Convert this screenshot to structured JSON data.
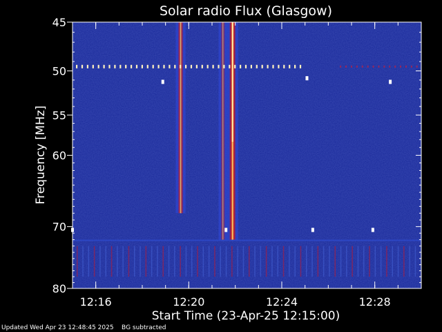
{
  "chart_data": {
    "type": "heatmap",
    "title": "Solar radio Flux (Glasgow)",
    "ylabel": "Frequency [MHz]",
    "xlabel": "Start Time (23-Apr-25 12:15:00)",
    "y_scale": "log",
    "ylim": [
      80,
      45
    ],
    "xlim": [
      "12:15:00",
      "12:30:00"
    ],
    "y_ticks": [
      45,
      50,
      55,
      60,
      70,
      80
    ],
    "x_ticks": [
      "12:16",
      "12:20",
      "12:24",
      "12:28"
    ],
    "colormap": [
      "#10107a",
      "#1a2ab0",
      "#2c44d0",
      "#8a1040",
      "#d01010",
      "#ff7010",
      "#ffe070",
      "#ffffff"
    ],
    "background_color": "#1a2a9a",
    "bursts": [
      {
        "time": "12:19:39",
        "f_min": 45,
        "f_max": 68,
        "intensity": 0.7
      },
      {
        "time": "12:21:53",
        "f_min": 45,
        "f_max": 72,
        "intensity": 1.0
      },
      {
        "time": "12:21:28",
        "f_min": 45,
        "f_max": 72,
        "intensity": 0.4
      }
    ],
    "rfi_band_mhz": 49.5
  },
  "footer": {
    "updated": "Updated Wed Apr 23 12:48:45 2025",
    "note": "BG subtracted"
  }
}
